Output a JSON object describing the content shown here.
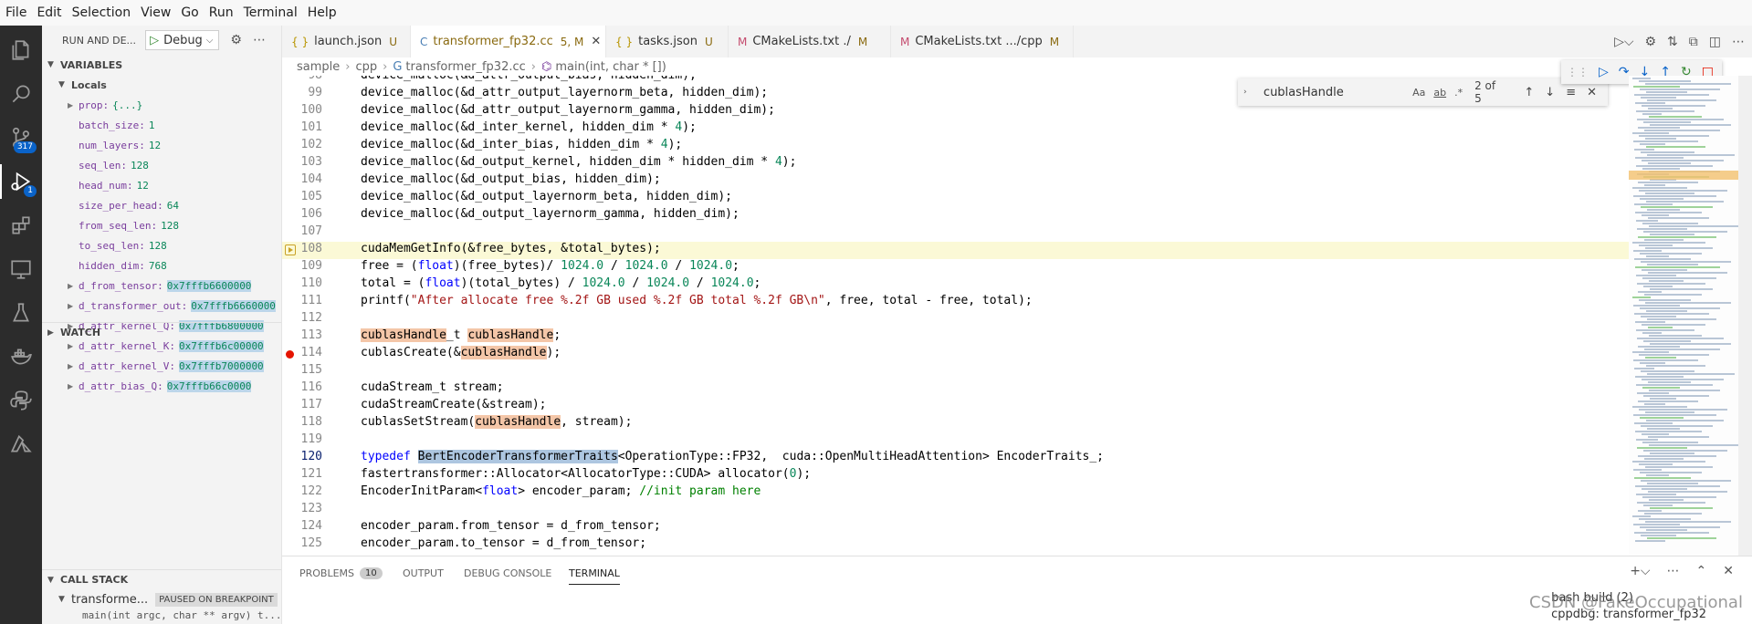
{
  "menu": [
    "File",
    "Edit",
    "Selection",
    "View",
    "Go",
    "Run",
    "Terminal",
    "Help"
  ],
  "activity": {
    "scm_badge": "317",
    "debug_badge": "1"
  },
  "sidebar": {
    "header": "RUN AND DE...",
    "config": "Debug",
    "variables_title": "VARIABLES",
    "locals_title": "Locals",
    "variables": [
      {
        "name": "prop:",
        "value": "{...}",
        "expandable": true
      },
      {
        "name": "batch_size:",
        "value": "1",
        "expandable": false
      },
      {
        "name": "num_layers:",
        "value": "12",
        "expandable": false
      },
      {
        "name": "seq_len:",
        "value": "128",
        "expandable": false
      },
      {
        "name": "head_num:",
        "value": "12",
        "expandable": false
      },
      {
        "name": "size_per_head:",
        "value": "64",
        "expandable": false
      },
      {
        "name": "from_seq_len:",
        "value": "128",
        "expandable": false
      },
      {
        "name": "to_seq_len:",
        "value": "128",
        "expandable": false
      },
      {
        "name": "hidden_dim:",
        "value": "768",
        "expandable": false
      },
      {
        "name": "d_from_tensor:",
        "value": "0x7fffb6600000",
        "expandable": true
      },
      {
        "name": "d_transformer_out:",
        "value": "0x7fffb6660000",
        "expandable": true
      },
      {
        "name": "d_attr_kernel_Q:",
        "value": "0x7fffb6800000",
        "expandable": true
      },
      {
        "name": "d_attr_kernel_K:",
        "value": "0x7fffb6c00000",
        "expandable": true
      },
      {
        "name": "d_attr_kernel_V:",
        "value": "0x7fffb7000000",
        "expandable": true
      },
      {
        "name": "d_attr_bias_Q:",
        "value": "0x7fffb66c0000",
        "expandable": true
      }
    ],
    "watch_title": "WATCH",
    "callstack_title": "CALL STACK",
    "callstack_thread": "transforme...",
    "callstack_status": "PAUSED ON BREAKPOINT",
    "callstack_frame": "main(int argc, char ** argv) t..."
  },
  "tabs": [
    {
      "icon": "{ }",
      "name": "launch.json",
      "status": "U",
      "active": false
    },
    {
      "icon": "C",
      "name": "transformer_fp32.cc",
      "status": "5, M",
      "active": true
    },
    {
      "icon": "{ }",
      "name": "tasks.json",
      "status": "U",
      "active": false
    },
    {
      "icon": "M",
      "name": "CMakeLists.txt ./",
      "status": "M",
      "active": false
    },
    {
      "icon": "M",
      "name": "CMakeLists.txt .../cpp",
      "status": "M",
      "active": false
    }
  ],
  "breadcrumb": [
    "sample",
    "cpp",
    "transformer_fp32.cc",
    "main(int, char * [])"
  ],
  "find": {
    "query": "cublasHandle",
    "count": "2 of 5",
    "opt_case": "Aa",
    "opt_word": "ab",
    "opt_regex": ".*"
  },
  "panel": {
    "tabs": [
      "PROBLEMS",
      "OUTPUT",
      "DEBUG CONSOLE",
      "TERMINAL"
    ],
    "problems_count": "10",
    "terminals": [
      "bash  build (2)",
      "cppdbg: transformer_fp32"
    ]
  },
  "watermark": "CSDN @FakeOccupational",
  "colors": {
    "accent": "#0a63c9",
    "breakpoint": "#e51400",
    "current_line": "#fbf9d6",
    "match_highlight": "#f4c6a8"
  }
}
